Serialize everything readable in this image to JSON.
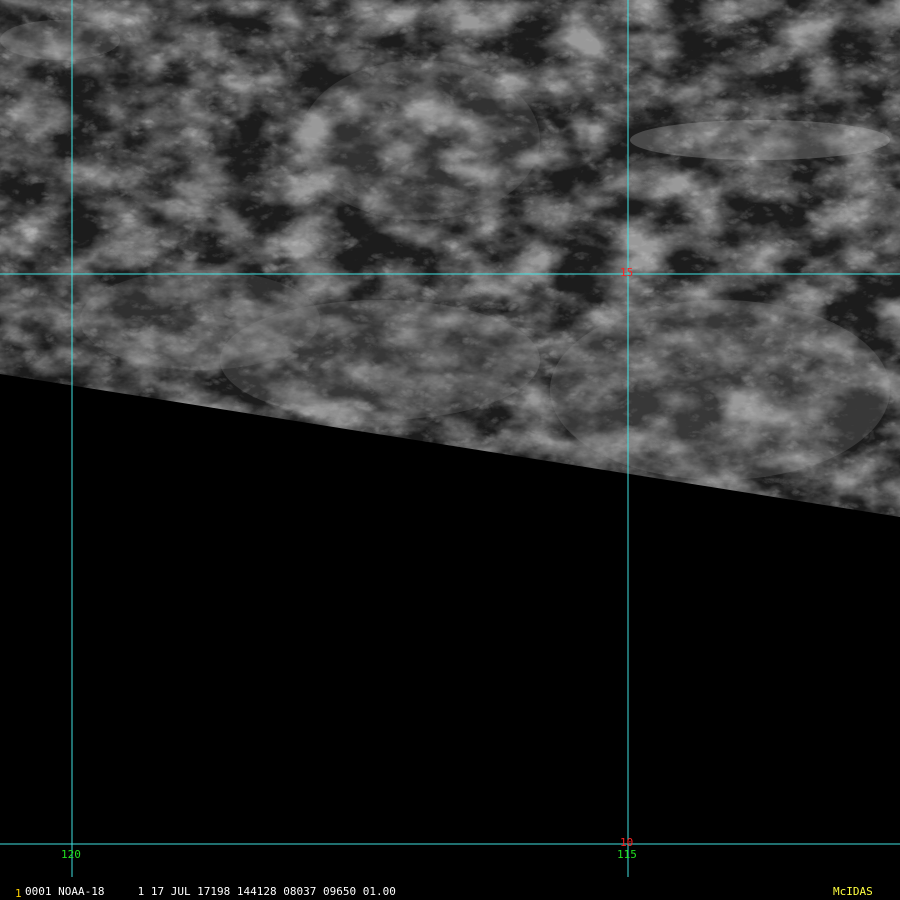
{
  "grid": {
    "line_color": "#40e0e0",
    "lat_labels": [
      "15",
      "10"
    ],
    "lon_labels": [
      "120",
      "115"
    ],
    "lat_label_color": "#ff2020",
    "lon_label_color": "#20e020"
  },
  "footer": {
    "frame_number": "1",
    "frame_number_color": "#ffd000",
    "info_text": "0001 NOAA-18     1 17 JUL 17198 144128 08037 09650 01.00",
    "info_color": "#ffffff",
    "brand": "McIDAS",
    "brand_color": "#ffff40"
  }
}
